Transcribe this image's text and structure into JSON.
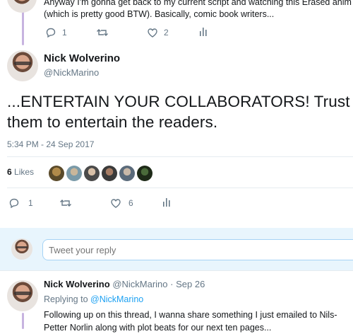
{
  "prev_tweet": {
    "text_line1": "Anyway I'm gonna get back to my current script and watching this Erased anim",
    "text_line2": "(which is pretty good BTW). Basically, comic book writers...",
    "reply_count": "1",
    "like_count": "2"
  },
  "main_tweet": {
    "author_name": "Nick Wolverino",
    "author_handle": "@NickMarino",
    "text_line1": "...ENTERTAIN YOUR COLLABORATORS! Trust",
    "text_line2": "them to entertain the readers.",
    "timestamp": "5:34 PM - 24 Sep 2017",
    "likes_count": "6",
    "likes_label": "Likes",
    "reply_count": "1",
    "like_count": "6"
  },
  "reply_box": {
    "placeholder": "Tweet your reply"
  },
  "next_tweet": {
    "author_name": "Nick Wolverino",
    "author_handle": "@NickMarino",
    "date": "· Sep 26",
    "replying_label": "Replying to",
    "replying_handle": "@NickMarino",
    "text_line1": "Following up on this thread, I wanna share something I just emailed to Nils-",
    "text_line2": "Petter Norlin along with plot beats for our next ten pages..."
  },
  "colors": {
    "accent": "#1da1f2",
    "muted": "#657786",
    "thread_line": "#c7b3e0"
  }
}
